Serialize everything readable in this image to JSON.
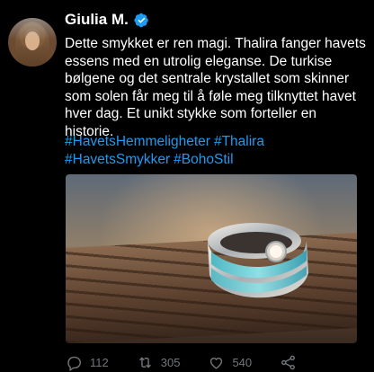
{
  "author": {
    "display_name": "Giulia M.",
    "verified": true,
    "badge_color": "#1d9bf0"
  },
  "tweet": {
    "text": "Dette smykket er ren magi. Thalira fanger havets essens med en utrolig eleganse. De turkise bølgene og det sentrale krystallet som skinner som solen får meg til å føle meg tilknyttet havet hver dag. Et unikt stykke som forteller en historie.",
    "hashtags": [
      "#HavetsHemmeligheter",
      "#Thalira",
      "#HavetsSmykker",
      "#BohoStil"
    ],
    "hashtag_color": "#1d9bf0"
  },
  "actions": {
    "reply_count": "112",
    "retweet_count": "305",
    "like_count": "540",
    "icons": [
      "reply-icon",
      "retweet-icon",
      "like-icon",
      "share-icon"
    ],
    "icon_color": "#71767b"
  }
}
